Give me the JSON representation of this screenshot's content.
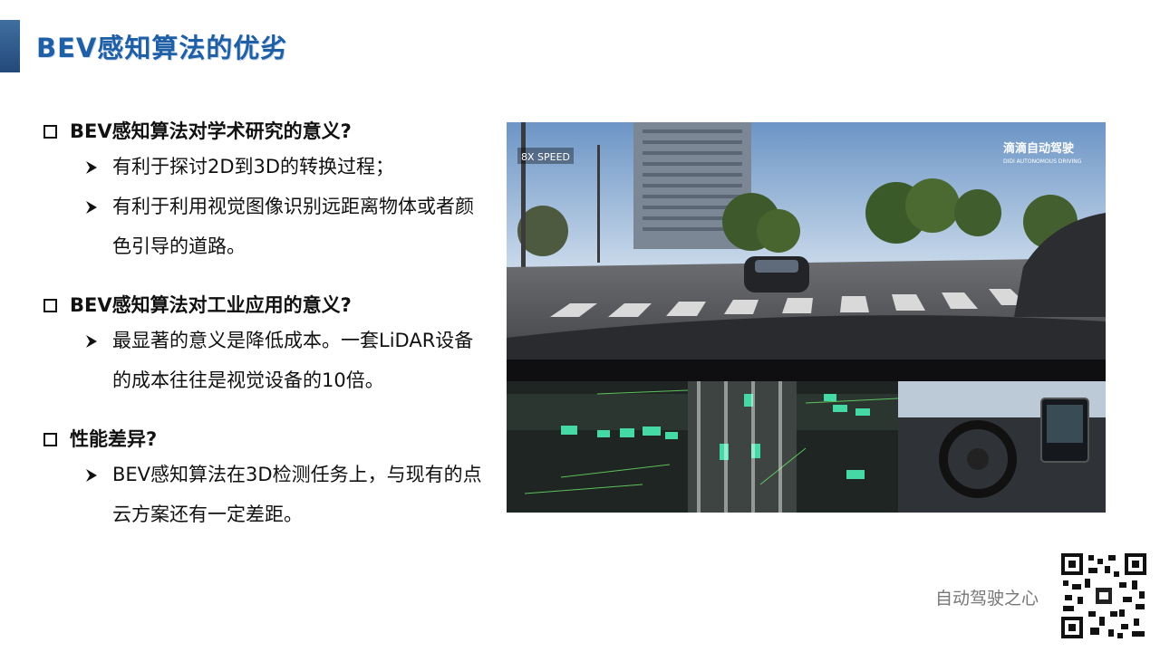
{
  "header": {
    "title": "BEV感知算法的优劣"
  },
  "sections": [
    {
      "question": "BEV感知算法对学术研究的意义?",
      "points": [
        "有利于探讨2D到3D的转换过程；",
        "有利于利用视觉图像识别远距离物体或者颜色引导的道路。"
      ]
    },
    {
      "question": "BEV感知算法对工业应用的意义?",
      "points": [
        "最显著的意义是降低成本。一套LiDAR设备的成本往往是视觉设备的10倍。"
      ]
    },
    {
      "question": "性能差异?",
      "points": [
        "BEV感知算法在3D检测任务上，与现有的点云方案还有一定差距。"
      ]
    }
  ],
  "image": {
    "speed_label": "8X SPEED",
    "brand_label": "滴滴自动驾驶",
    "brand_sub": "DIDI AUTONOMOUS DRIVING"
  },
  "watermark": "自动驾驶之心"
}
